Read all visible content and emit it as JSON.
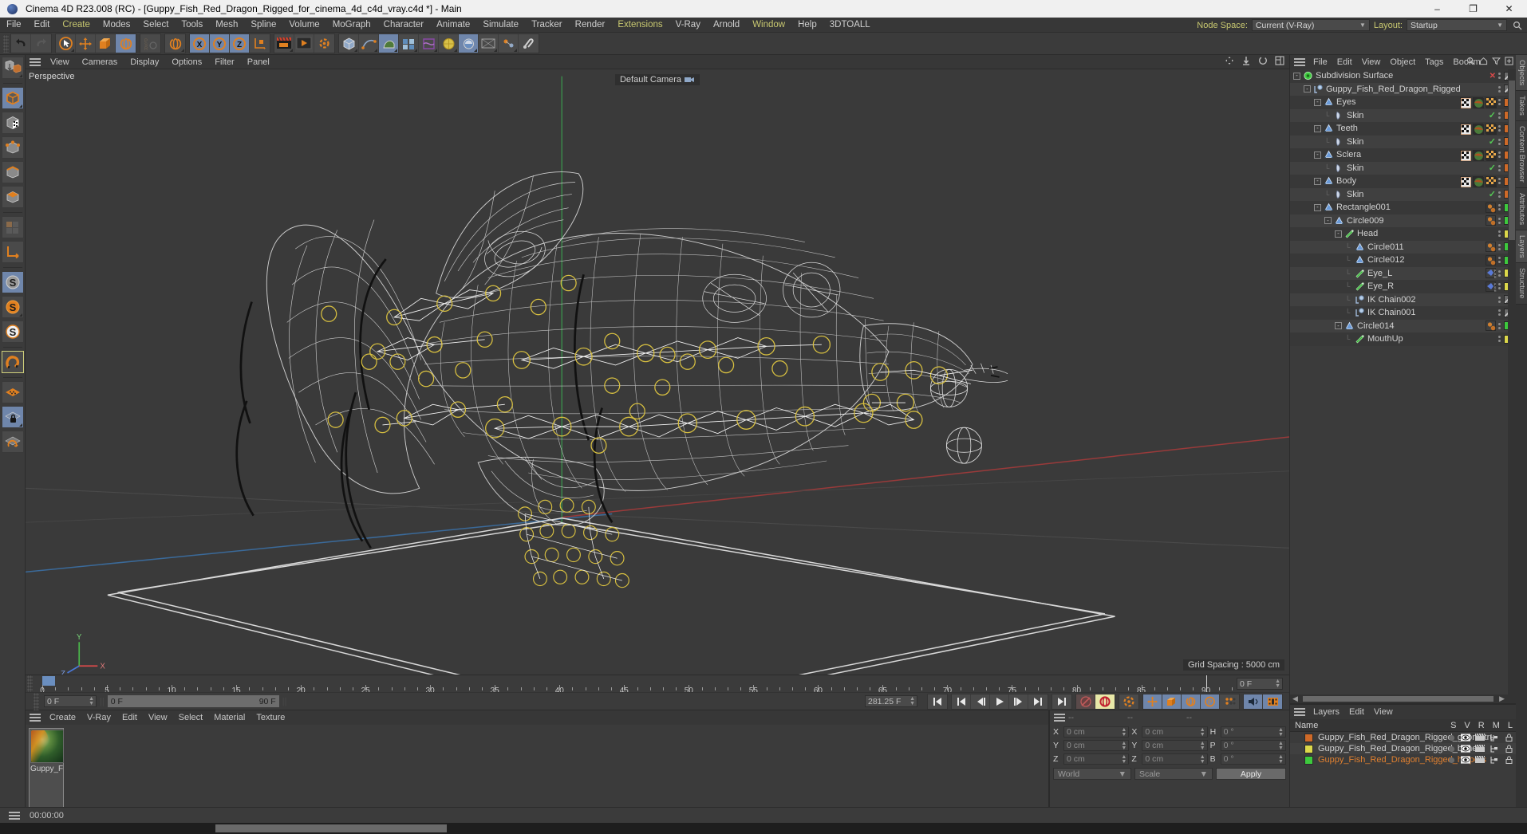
{
  "window": {
    "title": "Cinema 4D R23.008 (RC) - [Guppy_Fish_Red_Dragon_Rigged_for_cinema_4d_c4d_vray.c4d *] - Main",
    "minimize": "–",
    "maximize": "❐",
    "close": "✕"
  },
  "menubar": {
    "items": [
      {
        "label": "File"
      },
      {
        "label": "Edit"
      },
      {
        "label": "Create",
        "accent": true
      },
      {
        "label": "Modes"
      },
      {
        "label": "Select"
      },
      {
        "label": "Tools"
      },
      {
        "label": "Mesh"
      },
      {
        "label": "Spline"
      },
      {
        "label": "Volume"
      },
      {
        "label": "MoGraph"
      },
      {
        "label": "Character"
      },
      {
        "label": "Animate"
      },
      {
        "label": "Simulate"
      },
      {
        "label": "Tracker"
      },
      {
        "label": "Render"
      },
      {
        "label": "Extensions",
        "accent": true
      },
      {
        "label": "V-Ray"
      },
      {
        "label": "Arnold"
      },
      {
        "label": "Window",
        "accent": true
      },
      {
        "label": "Help"
      },
      {
        "label": "3DTOALL"
      }
    ],
    "node_space_label": "Node Space:",
    "node_space_value": "Current (V-Ray)",
    "layout_label": "Layout:",
    "layout_value": "Startup",
    "search_icon": "search-icon"
  },
  "viewport": {
    "menu": [
      {
        "label": "View",
        "accent": true
      },
      {
        "label": "Cameras"
      },
      {
        "label": "Display"
      },
      {
        "label": "Options",
        "accent": true
      },
      {
        "label": "Filter"
      },
      {
        "label": "Panel"
      }
    ],
    "label": "Perspective",
    "camera": "Default Camera",
    "grid_spacing": "Grid Spacing : 5000 cm",
    "axis_x": "X",
    "axis_y": "Y",
    "axis_z": "Z"
  },
  "timeline": {
    "ticks": [
      {
        "label": "0",
        "pos": 0
      },
      {
        "label": "5",
        "pos": 5
      },
      {
        "label": "10",
        "pos": 10
      },
      {
        "label": "15",
        "pos": 15
      },
      {
        "label": "20",
        "pos": 20
      },
      {
        "label": "25",
        "pos": 25
      },
      {
        "label": "30",
        "pos": 30
      },
      {
        "label": "35",
        "pos": 35
      },
      {
        "label": "40",
        "pos": 40
      },
      {
        "label": "45",
        "pos": 45
      },
      {
        "label": "50",
        "pos": 50
      },
      {
        "label": "55",
        "pos": 55
      },
      {
        "label": "60",
        "pos": 60
      },
      {
        "label": "65",
        "pos": 65
      },
      {
        "label": "70",
        "pos": 70
      },
      {
        "label": "75",
        "pos": 75
      },
      {
        "label": "80",
        "pos": 80
      },
      {
        "label": "85",
        "pos": 85
      },
      {
        "label": "90",
        "pos": 90
      }
    ],
    "min": 0,
    "max": 92,
    "current_frame": "0 F",
    "range_start": "0 F",
    "range_end": "90 F",
    "end_field": "0 F",
    "fps_field": "281.25 F"
  },
  "transport": {
    "first_frame": "first-frame-icon",
    "prev_key": "prev-keyframe-icon",
    "prev_frame": "prev-frame-icon",
    "play": "play-icon",
    "next_frame": "next-frame-icon",
    "next_key": "next-keyframe-icon",
    "last_frame": "last-frame-icon",
    "record_off": "record-disabled-icon",
    "autokey": "autokey-icon",
    "key_settings": "keyframe-settings-icon",
    "pos_key": "position-key-icon",
    "scale_key": "scale-key-icon",
    "rot_key": "rotation-key-icon",
    "param_key": "parameter-key-icon",
    "point_key": "point-level-key-icon",
    "sound": "sound-icon",
    "frames": "frames-icon"
  },
  "material_panel": {
    "menu": [
      {
        "label": "Create"
      },
      {
        "label": "V-Ray"
      },
      {
        "label": "Edit"
      },
      {
        "label": "View"
      },
      {
        "label": "Select"
      },
      {
        "label": "Material"
      },
      {
        "label": "Texture"
      }
    ],
    "materials": [
      {
        "name": "Guppy_F"
      }
    ]
  },
  "coordinates": {
    "header": [
      "--",
      "--",
      "--"
    ],
    "rows": [
      {
        "l1": "X",
        "v1": "0 cm",
        "l2": "X",
        "v2": "0 cm",
        "l3": "H",
        "v3": "0 °"
      },
      {
        "l1": "Y",
        "v1": "0 cm",
        "l2": "Y",
        "v2": "0 cm",
        "l3": "P",
        "v3": "0 °"
      },
      {
        "l1": "Z",
        "v1": "0 cm",
        "l2": "Z",
        "v2": "0 cm",
        "l3": "B",
        "v3": "0 °"
      }
    ],
    "world": "World",
    "scale": "Scale",
    "apply": "Apply"
  },
  "object_manager": {
    "menu": [
      {
        "label": "File"
      },
      {
        "label": "Edit"
      },
      {
        "label": "View"
      },
      {
        "label": "Object"
      },
      {
        "label": "Tags",
        "accent": true
      },
      {
        "label": "Bookm"
      }
    ],
    "rows": [
      {
        "name": "Subdivision Surface",
        "depth": 0,
        "icon": "subdivision-surface-icon",
        "expander": "-",
        "swatch": "diag",
        "dots": true,
        "close": true,
        "tags": []
      },
      {
        "name": "Guppy_Fish_Red_Dragon_Rigged",
        "depth": 1,
        "icon": "null-object-icon",
        "expander": "-",
        "swatch": "diag",
        "dots": true,
        "tags": []
      },
      {
        "name": "Eyes",
        "depth": 2,
        "icon": "polygon-object-icon",
        "expander": "-",
        "swatch": "#cf6a28",
        "dots": true,
        "tags": [
          "uv",
          "material",
          "checker"
        ]
      },
      {
        "name": "Skin",
        "depth": 3,
        "icon": "skin-deformer-icon",
        "expander": "",
        "swatch": "#cf6a28",
        "dots": true,
        "check": true,
        "tags": []
      },
      {
        "name": "Teeth",
        "depth": 2,
        "icon": "polygon-object-icon",
        "expander": "-",
        "swatch": "#cf6a28",
        "dots": true,
        "tags": [
          "uv",
          "material",
          "checker"
        ]
      },
      {
        "name": "Skin",
        "depth": 3,
        "icon": "skin-deformer-icon",
        "expander": "",
        "swatch": "#cf6a28",
        "dots": true,
        "check": true,
        "tags": []
      },
      {
        "name": "Sclera",
        "depth": 2,
        "icon": "polygon-object-icon",
        "expander": "-",
        "swatch": "#cf6a28",
        "dots": true,
        "tags": [
          "uv",
          "material",
          "checker"
        ]
      },
      {
        "name": "Skin",
        "depth": 3,
        "icon": "skin-deformer-icon",
        "expander": "",
        "swatch": "#cf6a28",
        "dots": true,
        "check": true,
        "tags": []
      },
      {
        "name": "Body",
        "depth": 2,
        "icon": "polygon-object-icon",
        "expander": "-",
        "swatch": "#cf6a28",
        "dots": true,
        "tags": [
          "uv",
          "material",
          "checker"
        ]
      },
      {
        "name": "Skin",
        "depth": 3,
        "icon": "skin-deformer-icon",
        "expander": "",
        "swatch": "#cf6a28",
        "dots": true,
        "check": true,
        "tags": []
      },
      {
        "name": "Rectangle001",
        "depth": 2,
        "icon": "polygon-object-icon",
        "expander": "-",
        "swatch": "#3dc93d",
        "dots": true,
        "tags": [
          "spheres"
        ]
      },
      {
        "name": "Circle009",
        "depth": 3,
        "icon": "polygon-object-icon",
        "expander": "-",
        "swatch": "#3dc93d",
        "dots": true,
        "tags": [
          "spheres"
        ]
      },
      {
        "name": "Head",
        "depth": 4,
        "icon": "joint-icon",
        "expander": "-",
        "swatch": "#dcd84a",
        "dots": true,
        "tags": []
      },
      {
        "name": "Circle011",
        "depth": 5,
        "icon": "polygon-object-icon",
        "expander": "",
        "swatch": "#3dc93d",
        "dots": true,
        "tags": [
          "spheres"
        ]
      },
      {
        "name": "Circle012",
        "depth": 5,
        "icon": "polygon-object-icon",
        "expander": "",
        "swatch": "#3dc93d",
        "dots": true,
        "tags": [
          "spheres"
        ]
      },
      {
        "name": "Eye_L",
        "depth": 5,
        "icon": "joint-icon",
        "expander": "",
        "swatch": "#dcd84a",
        "dots": true,
        "tags": [
          "psr"
        ]
      },
      {
        "name": "Eye_R",
        "depth": 5,
        "icon": "joint-icon",
        "expander": "",
        "swatch": "#dcd84a",
        "dots": true,
        "tags": [
          "psr"
        ]
      },
      {
        "name": "IK Chain002",
        "depth": 5,
        "icon": "null-object-icon",
        "expander": "",
        "swatch": "diag",
        "dots": true,
        "tags": []
      },
      {
        "name": "IK Chain001",
        "depth": 5,
        "icon": "null-object-icon",
        "expander": "",
        "swatch": "diag",
        "dots": true,
        "tags": []
      },
      {
        "name": "Circle014",
        "depth": 4,
        "icon": "polygon-object-icon",
        "expander": "-",
        "swatch": "#3dc93d",
        "dots": true,
        "tags": [
          "spheres"
        ]
      },
      {
        "name": "MouthUp",
        "depth": 5,
        "icon": "joint-icon",
        "expander": "",
        "swatch": "#dcd84a",
        "dots": true,
        "tags": []
      }
    ],
    "side_tabs": [
      "Objects",
      "Takes",
      "Content Browser"
    ]
  },
  "layer_manager": {
    "menu": [
      {
        "label": "Layers"
      },
      {
        "label": "Edit"
      },
      {
        "label": "View"
      }
    ],
    "columns": [
      "Name",
      "S",
      "V",
      "R",
      "M",
      "L"
    ],
    "rows": [
      {
        "name": "Guppy_Fish_Red_Dragon_Rigged_geometru",
        "color": "#cf6a28",
        "highlight": false
      },
      {
        "name": "Guppy_Fish_Red_Dragon_Rigged_bones",
        "color": "#dcd84a",
        "highlight": false
      },
      {
        "name": "Guppy_Fish_Red_Dragon_Rigged_helpers",
        "color": "#3dc93d",
        "highlight": true
      }
    ],
    "side_tabs": [
      "Attributes",
      "Layers",
      "Structure"
    ]
  },
  "statusbar": {
    "time": "00:00:00"
  },
  "colors": {
    "accent_orange": "#e08020",
    "select_blue": "#6f86ab",
    "green": "#3dc93d",
    "yellow": "#dcd84a",
    "orange_swatch": "#cf6a28",
    "panel_bg": "#3b3b3b"
  }
}
